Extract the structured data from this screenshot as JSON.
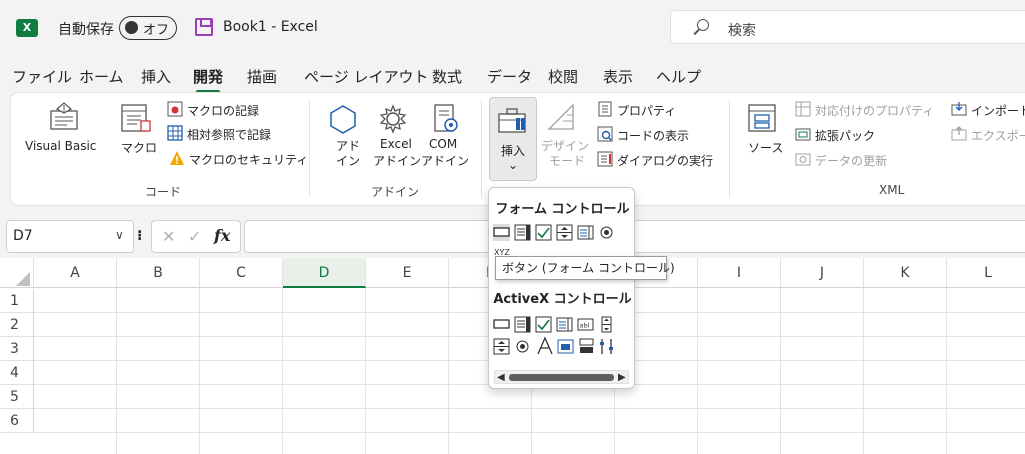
{
  "titlebar": {
    "autosave_label": "自動保存",
    "autosave_state": "オフ",
    "doc_title": "Book1  -  Excel",
    "search_placeholder": "検索",
    "excel_logo_letter": "X"
  },
  "menu": {
    "tabs": [
      "ファイル",
      "ホーム",
      "挿入",
      "開発",
      "描画",
      "ページ レイアウト",
      "数式",
      "データ",
      "校閲",
      "表示",
      "ヘルプ"
    ],
    "active": "開発"
  },
  "ribbon": {
    "code": {
      "visual_basic": "Visual Basic",
      "macro": "マクロ",
      "record_macro": "マクロの記録",
      "relative_ref": "相対参照で記録",
      "macro_security": "マクロのセキュリティ",
      "group_label": "コード"
    },
    "addins": {
      "addin_line1": "アド",
      "addin_line2": "イン",
      "excel_addin_line1": "Excel",
      "excel_addin_line2": "アドイン",
      "com_addin_line1": "COM",
      "com_addin_line2": "アドイン",
      "group_label": "アドイン"
    },
    "controls": {
      "insert": "挿入",
      "insert_arrow": "⌄",
      "design_mode_line1": "デザイン",
      "design_mode_line2": "モード",
      "properties": "プロパティ",
      "view_code": "コードの表示",
      "run_dialog": "ダイアログの実行"
    },
    "xml": {
      "source": "ソース",
      "map_properties": "対応付けのプロパティ",
      "expansion_packs": "拡張パック",
      "refresh_data": "データの更新",
      "import": "インポート",
      "export": "エクスポート",
      "group_label": "XML"
    }
  },
  "formula_bar": {
    "name_box": "D7",
    "name_box_arrow": "∨",
    "dots": "⁝",
    "cancel": "✕",
    "enter": "✓",
    "fx": "fx"
  },
  "grid": {
    "columns": [
      "A",
      "B",
      "C",
      "D",
      "E",
      "F",
      "G",
      "H",
      "I",
      "J",
      "K",
      "L"
    ],
    "selected_column": "D",
    "rows": [
      "1",
      "2",
      "3",
      "4",
      "5",
      "6"
    ]
  },
  "dropdown": {
    "form_controls_title": "フォーム コントロール",
    "activex_title": "ActiveX コントロール",
    "tooltip": "ボタン (フォーム コントロール)",
    "scroll_left": "◀",
    "scroll_right": "▶"
  },
  "colors": {
    "accent": "#107c41",
    "autosave_save_icon": "#9b3db8",
    "warning": "#f2a900",
    "blue_icon": "#1f5fae"
  }
}
